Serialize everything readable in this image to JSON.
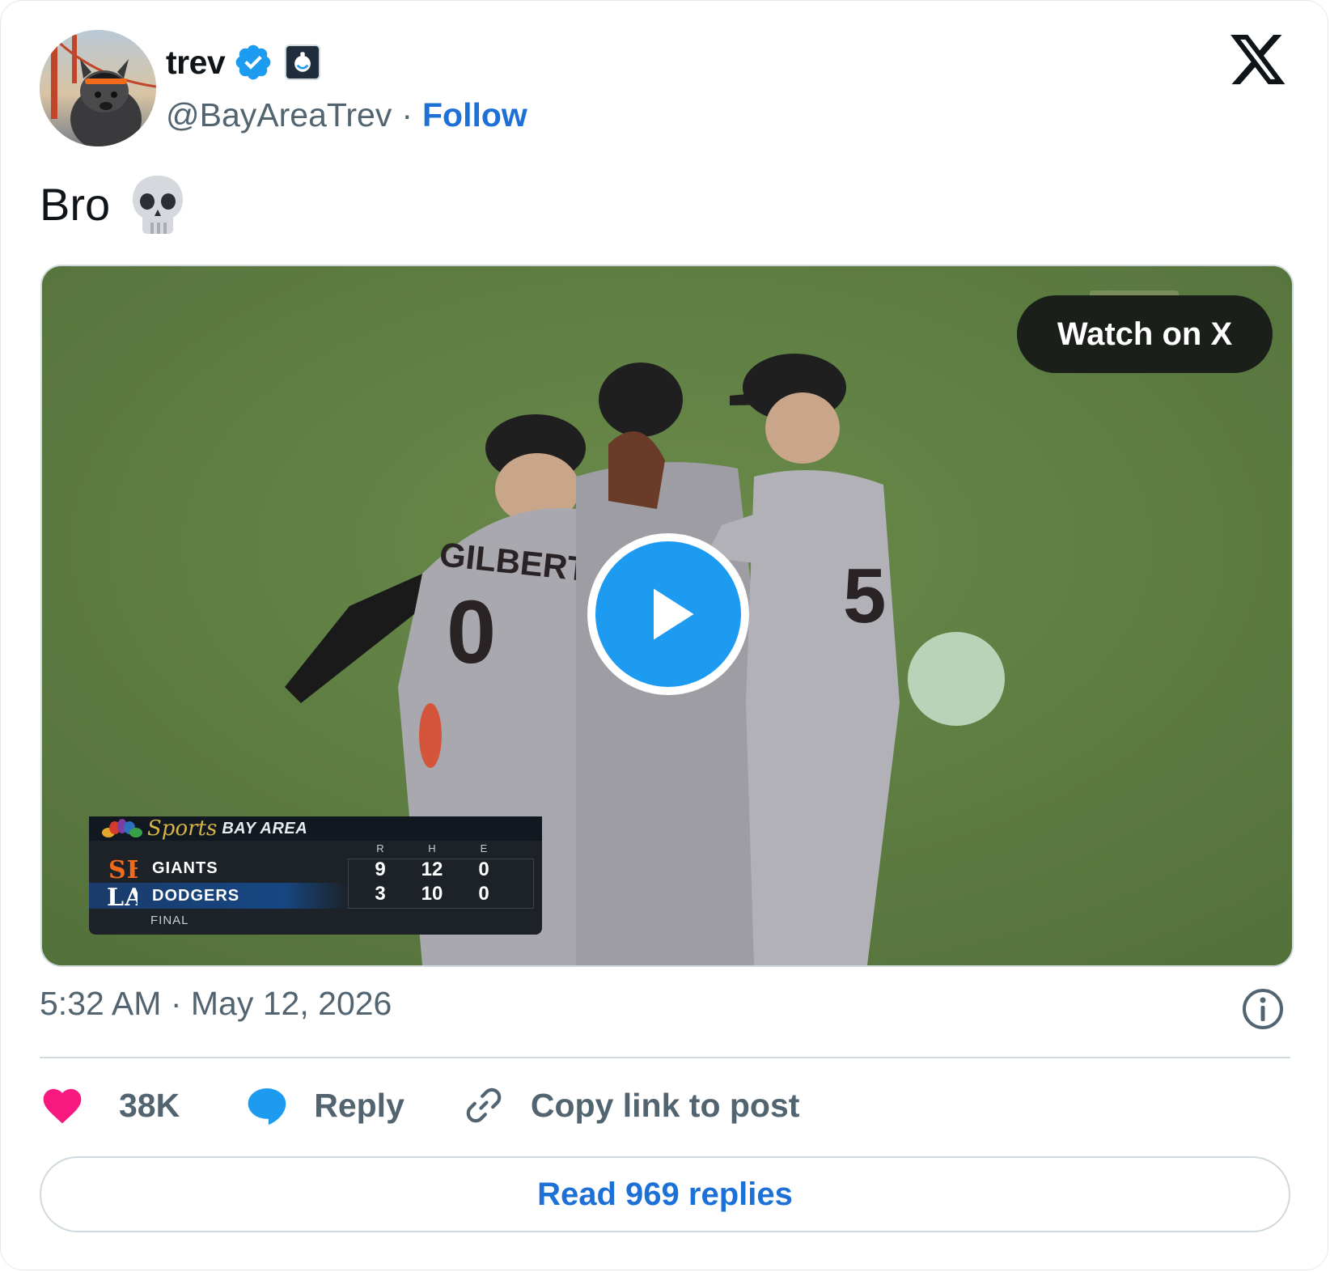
{
  "author": {
    "display_name": "trev",
    "handle": "@BayAreaTrev",
    "separator": "·",
    "follow_label": "Follow",
    "verified": true
  },
  "tweet": {
    "text": "Bro",
    "emoji": "skull"
  },
  "media": {
    "watch_label": "Watch on X",
    "scorebug": {
      "network_sports": "Sports",
      "network_region": "BAY AREA",
      "columns": [
        "R",
        "H",
        "E"
      ],
      "teams": [
        {
          "name": "GIANTS",
          "R": "9",
          "H": "12",
          "E": "0"
        },
        {
          "name": "DODGERS",
          "R": "3",
          "H": "10",
          "E": "0"
        }
      ],
      "status": "FINAL"
    }
  },
  "meta": {
    "time": "5:32 AM",
    "separator": "·",
    "date": "May 12, 2026"
  },
  "actions": {
    "likes_count": "38K",
    "reply_label": "Reply",
    "copy_label": "Copy link to post"
  },
  "read_replies_label": "Read 969 replies",
  "colors": {
    "accent_blue": "#1d9bf0",
    "link_blue": "#1d70d6",
    "like_pink": "#f91880",
    "muted_text": "#536471",
    "border": "#cfd9de"
  },
  "icons": {
    "brand": "x-logo-icon",
    "verified": "verified-badge-icon",
    "affiliate": "affiliate-badge-icon",
    "play": "play-icon",
    "info": "info-icon",
    "like": "heart-icon",
    "reply": "speech-bubble-icon",
    "copy": "link-icon"
  }
}
